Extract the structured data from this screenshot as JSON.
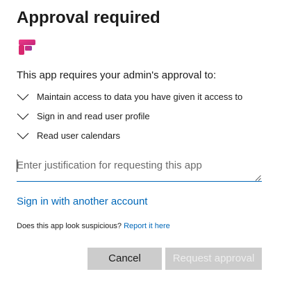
{
  "dialog": {
    "title": "Approval required",
    "app_logo_icon": "app-logo-icon",
    "intro": "This app requires your admin's approval to:",
    "permissions": [
      {
        "label": "Maintain access to data you have given it access to",
        "icon": "chevron-down-icon"
      },
      {
        "label": "Sign in and read user profile",
        "icon": "chevron-down-icon"
      },
      {
        "label": "Read user calendars",
        "icon": "chevron-down-icon"
      }
    ],
    "justification": {
      "value": "",
      "placeholder": "Enter justification for requesting this app"
    },
    "alt_account_link": "Sign in with another account",
    "suspicious_text": "Does this app look suspicious?",
    "report_link": "Report it here",
    "buttons": {
      "cancel": "Cancel",
      "request": "Request approval"
    }
  },
  "colors": {
    "text": "#1b1b1b",
    "link": "#0067b8",
    "input_underline": "#0067b8",
    "button_bg": "#cccccc",
    "disabled_text": "#eeeeee",
    "logo_pink": "#e8317c",
    "logo_purple": "#8a3fa3"
  }
}
